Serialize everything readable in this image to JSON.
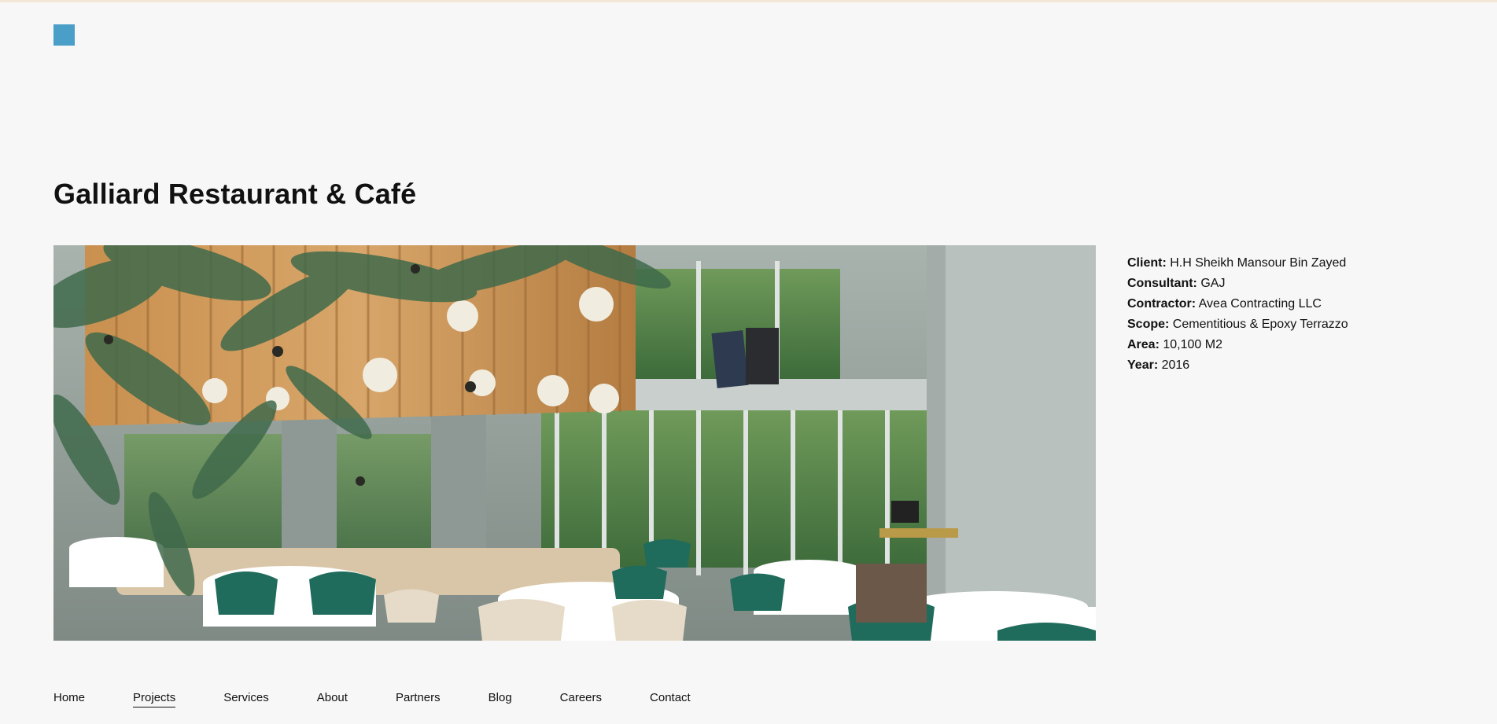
{
  "project": {
    "title": "Galliard Restaurant & Café",
    "details": [
      {
        "label": "Client:",
        "value": " H.H Sheikh Mansour Bin Zayed"
      },
      {
        "label": "Consultant:",
        "value": " GAJ"
      },
      {
        "label": "Contractor:",
        "value": " Avea Contracting LLC"
      },
      {
        "label": "Scope:",
        "value": " Cementitious & Epoxy Terrazzo"
      },
      {
        "label": "Area:",
        "value": " 10,100 M2"
      },
      {
        "label": "Year:",
        "value": " 2016"
      }
    ]
  },
  "nav": {
    "items": [
      {
        "label": "Home",
        "active": false
      },
      {
        "label": "Projects",
        "active": true
      },
      {
        "label": "Services",
        "active": false
      },
      {
        "label": "About",
        "active": false
      },
      {
        "label": "Partners",
        "active": false
      },
      {
        "label": "Blog",
        "active": false
      },
      {
        "label": "Careers",
        "active": false
      },
      {
        "label": "Contact",
        "active": false
      }
    ]
  },
  "colors": {
    "logo": "#4a9fc9",
    "background": "#f7f7f7",
    "text": "#111111"
  }
}
